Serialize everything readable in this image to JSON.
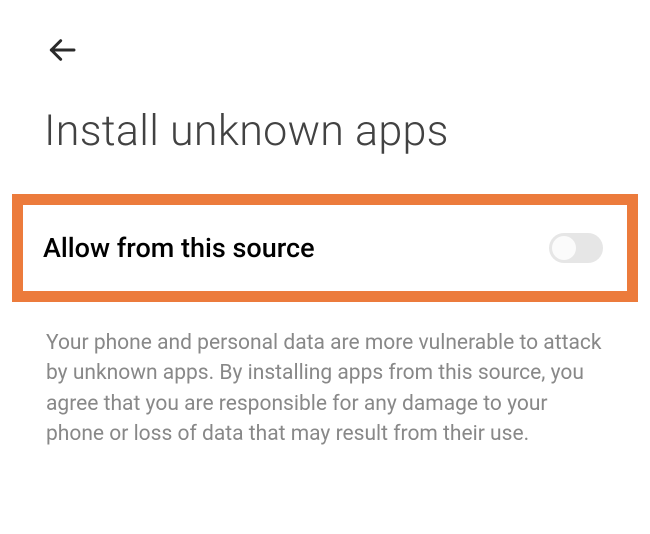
{
  "header": {
    "title": "Install unknown apps"
  },
  "setting": {
    "label": "Allow from this source",
    "enabled": false
  },
  "description": {
    "text": "Your phone and personal data are more vulnerable to attack by unknown apps. By installing apps from this source, you agree that you are responsible for any damage to your phone or loss of data that may result from their use."
  },
  "highlight": {
    "color": "#ec7b3c"
  }
}
